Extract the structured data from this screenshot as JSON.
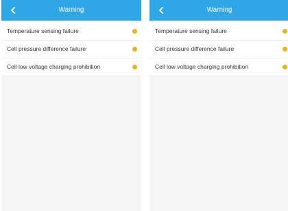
{
  "colors": {
    "header": "#2fa6e6",
    "warning_dot": "#f0b416",
    "background": "#f5f5f5"
  },
  "screens": [
    {
      "header": {
        "title": "Warning",
        "back_icon": "chevron-left-icon"
      },
      "items": [
        {
          "label": "Temperature sensing failure",
          "icon": "warning-dot-icon"
        },
        {
          "label": "Cell pressure difference failure",
          "icon": "warning-dot-icon"
        },
        {
          "label": "Cell low voltage charging prohibition",
          "icon": "warning-dot-icon"
        }
      ]
    },
    {
      "header": {
        "title": "Warning",
        "back_icon": "chevron-left-icon"
      },
      "items": [
        {
          "label": "Temperature sensing failure",
          "icon": "warning-dot-icon"
        },
        {
          "label": "Cell pressure difference failure",
          "icon": "warning-dot-icon"
        },
        {
          "label": "Cell low voltage charging prohibition",
          "icon": "warning-dot-icon"
        }
      ]
    }
  ]
}
